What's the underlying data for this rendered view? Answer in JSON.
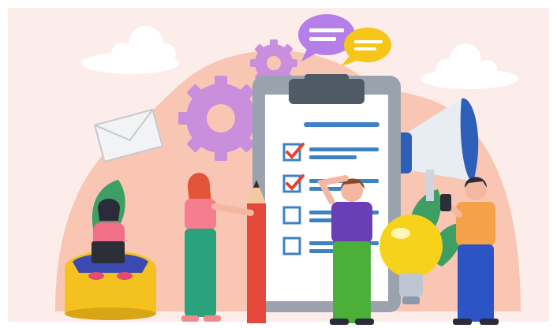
{
  "palette": {
    "frame": "#ffffff",
    "background": "#fcecea",
    "blob": "#f9c6b4",
    "cloud": "#ffffff",
    "gear": "#c98fdc",
    "clipboard_frame": "#9aa3ad",
    "clipboard_paper": "#ffffff",
    "clip": "#4f5a66",
    "check_red": "#e0452f",
    "line_blue": "#3f82c4",
    "pencil_red": "#e3483a",
    "megaphone": "#2e5fb8",
    "bulb_yellow": "#f6d21b",
    "leaf_green": "#3d9f64",
    "chat_purple": "#b57ee8",
    "chat_yellow": "#f5c518",
    "envelope": "#f2f3f5",
    "pouf_yellow": "#f4c21e"
  },
  "checklist": {
    "items": [
      {
        "checked": true
      },
      {
        "checked": true
      },
      {
        "checked": false
      },
      {
        "checked": false
      }
    ]
  },
  "people": [
    {
      "role": "woman-with-laptop",
      "shirt": "#f26f8a",
      "pants": "#3a4ab0"
    },
    {
      "role": "woman-with-pencil",
      "shirt": "#f57e8e",
      "pants": "#2aa37c"
    },
    {
      "role": "man-thinking",
      "shirt": "#6a3fb6",
      "pants": "#4bb03a"
    },
    {
      "role": "man-with-phone",
      "shirt": "#f4a14a",
      "pants": "#2d54c4"
    }
  ],
  "icons": [
    "gear-icon",
    "chat-bubble-icon",
    "envelope-icon",
    "megaphone-icon",
    "lightbulb-icon",
    "pencil-icon",
    "checkbox-icon",
    "cloud-icon"
  ]
}
